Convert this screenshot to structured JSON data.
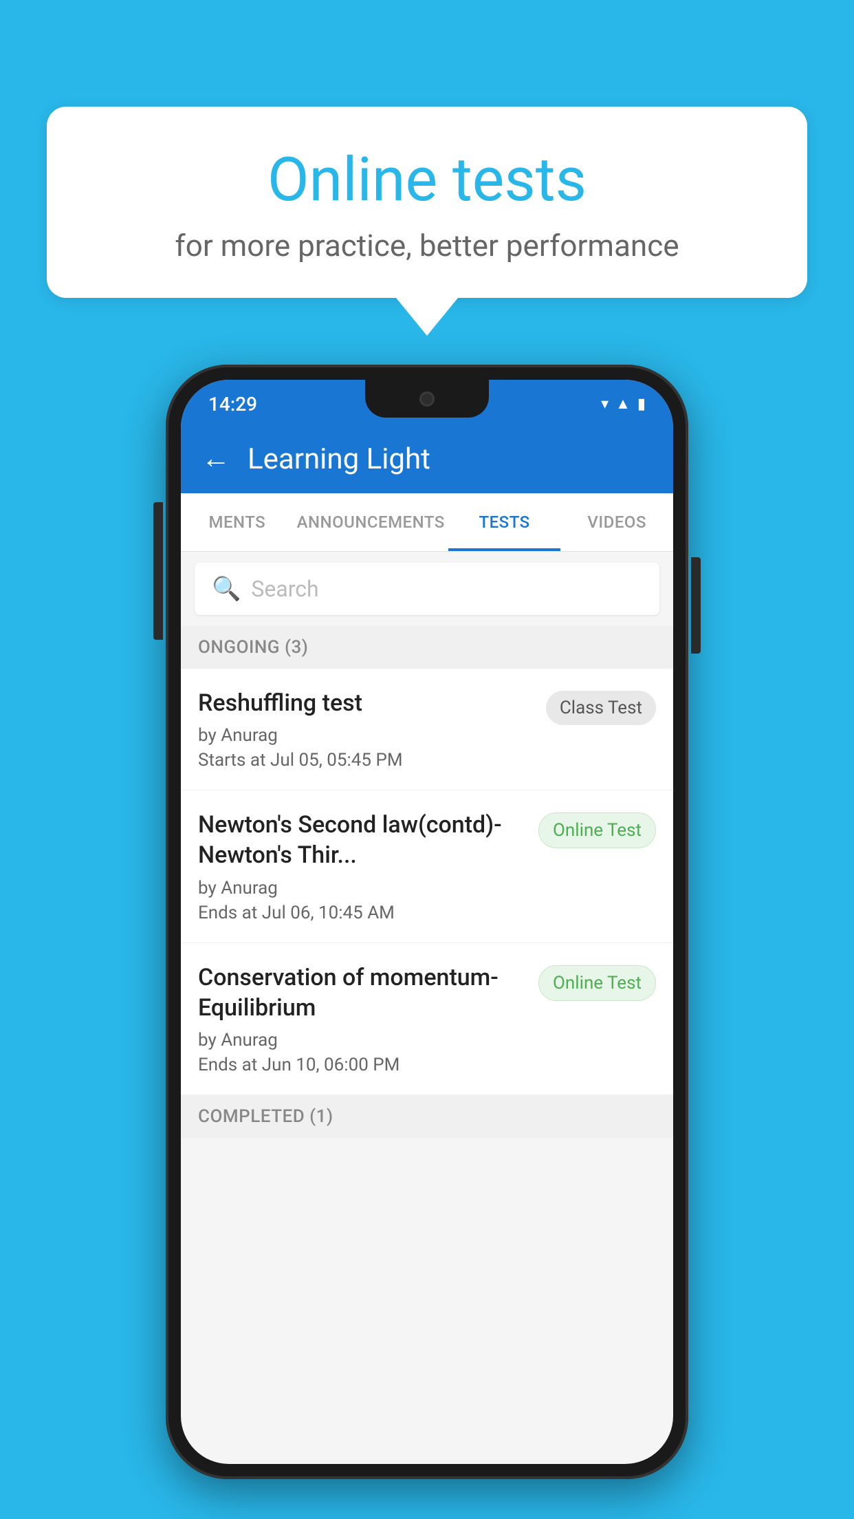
{
  "background": {
    "color": "#29B6E8"
  },
  "speech_bubble": {
    "title": "Online tests",
    "subtitle": "for more practice, better performance"
  },
  "phone": {
    "status_bar": {
      "time": "14:29",
      "icons": [
        "wifi",
        "signal",
        "battery"
      ]
    },
    "header": {
      "title": "Learning Light",
      "back_label": "←"
    },
    "tabs": [
      {
        "label": "MENTS",
        "active": false
      },
      {
        "label": "ANNOUNCEMENTS",
        "active": false
      },
      {
        "label": "TESTS",
        "active": true
      },
      {
        "label": "VIDEOS",
        "active": false
      }
    ],
    "search": {
      "placeholder": "Search"
    },
    "ongoing_section": {
      "label": "ONGOING (3)"
    },
    "tests": [
      {
        "name": "Reshuffling test",
        "author": "by Anurag",
        "date_label": "Starts at",
        "date": "Jul 05, 05:45 PM",
        "badge": "Class Test",
        "badge_type": "class"
      },
      {
        "name": "Newton's Second law(contd)-Newton's Thir...",
        "author": "by Anurag",
        "date_label": "Ends at",
        "date": "Jul 06, 10:45 AM",
        "badge": "Online Test",
        "badge_type": "online"
      },
      {
        "name": "Conservation of momentum-Equilibrium",
        "author": "by Anurag",
        "date_label": "Ends at",
        "date": "Jun 10, 06:00 PM",
        "badge": "Online Test",
        "badge_type": "online"
      }
    ],
    "completed_section": {
      "label": "COMPLETED (1)"
    }
  }
}
